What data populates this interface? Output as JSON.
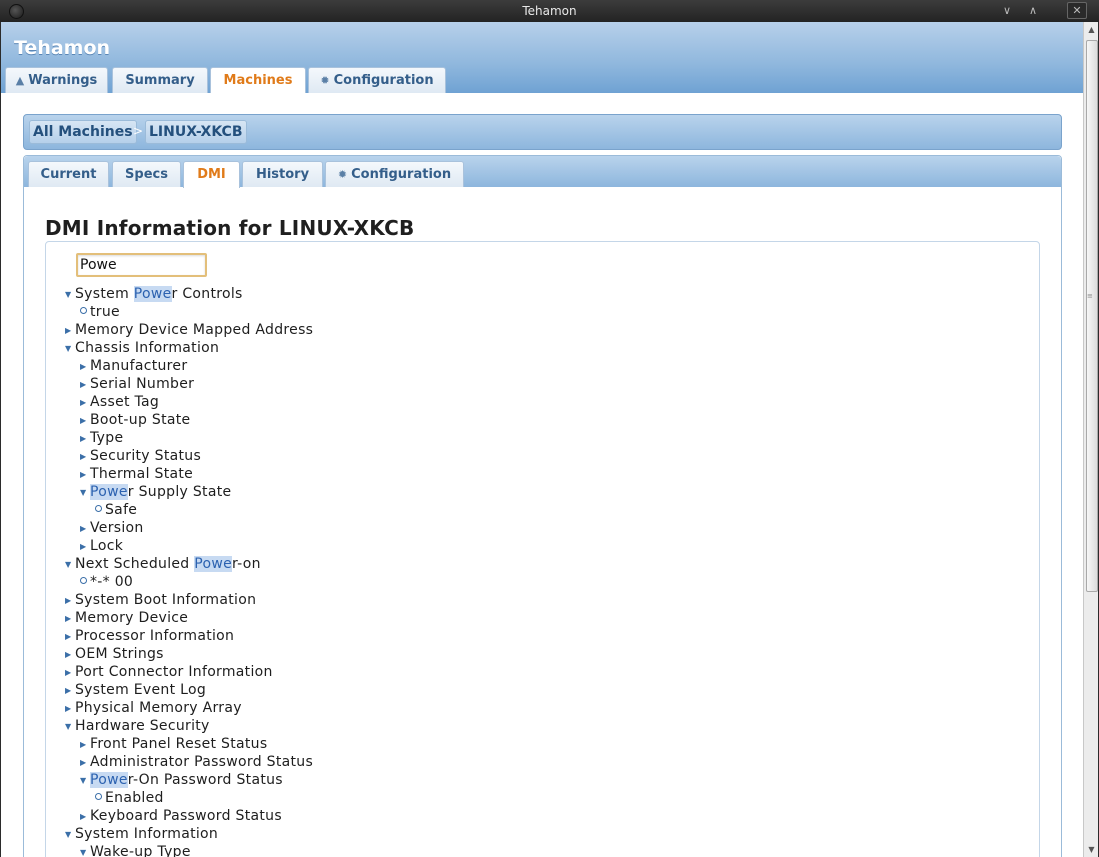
{
  "window": {
    "title": "Tehamon"
  },
  "app": {
    "brand": "Tehamon"
  },
  "main_tabs": [
    {
      "label": "Warnings",
      "icon": "warning-icon"
    },
    {
      "label": "Summary"
    },
    {
      "label": "Machines",
      "active": true
    },
    {
      "label": "Configuration",
      "icon": "gear-icon"
    }
  ],
  "breadcrumb": {
    "root": "All Machines",
    "separator": ">",
    "current": "LINUX-XKCB"
  },
  "sub_tabs": [
    {
      "label": "Current"
    },
    {
      "label": "Specs"
    },
    {
      "label": "DMI",
      "active": true
    },
    {
      "label": "History"
    },
    {
      "label": "Configuration",
      "icon": "gear-icon"
    }
  ],
  "dmi": {
    "title": "DMI Information for LINUX-XKCB",
    "filter_value": "Powe",
    "tree": [
      {
        "label": "System Power Controls",
        "expanded": true,
        "highlight": "Powe"
      },
      {
        "label": "true",
        "leaf": true
      },
      {
        "label": "Memory Device Mapped Address"
      },
      {
        "label": "Chassis Information",
        "expanded": true
      },
      {
        "label": "Manufacturer"
      },
      {
        "label": "Serial Number"
      },
      {
        "label": "Asset Tag"
      },
      {
        "label": "Boot-up State"
      },
      {
        "label": "Type"
      },
      {
        "label": "Security Status"
      },
      {
        "label": "Thermal State"
      },
      {
        "label": "Power Supply State",
        "expanded": true,
        "highlight": "Powe"
      },
      {
        "label": "Safe",
        "leaf": true
      },
      {
        "label": "Version"
      },
      {
        "label": "Lock"
      },
      {
        "label": "Next Scheduled Power-on",
        "expanded": true,
        "highlight": "Powe"
      },
      {
        "label": "*-* 00",
        "leaf": true
      },
      {
        "label": "System Boot Information"
      },
      {
        "label": "Memory Device"
      },
      {
        "label": "Processor Information"
      },
      {
        "label": "OEM Strings"
      },
      {
        "label": "Port Connector Information"
      },
      {
        "label": "System Event Log"
      },
      {
        "label": "Physical Memory Array"
      },
      {
        "label": "Hardware Security",
        "expanded": true
      },
      {
        "label": "Front Panel Reset Status"
      },
      {
        "label": "Administrator Password Status"
      },
      {
        "label": "Power-On Password Status",
        "expanded": true,
        "highlight": "Powe"
      },
      {
        "label": "Enabled",
        "leaf": true
      },
      {
        "label": "Keyboard Password Status"
      },
      {
        "label": "System Information",
        "expanded": true
      },
      {
        "label": "Wake-up Type",
        "expanded": true
      }
    ]
  }
}
